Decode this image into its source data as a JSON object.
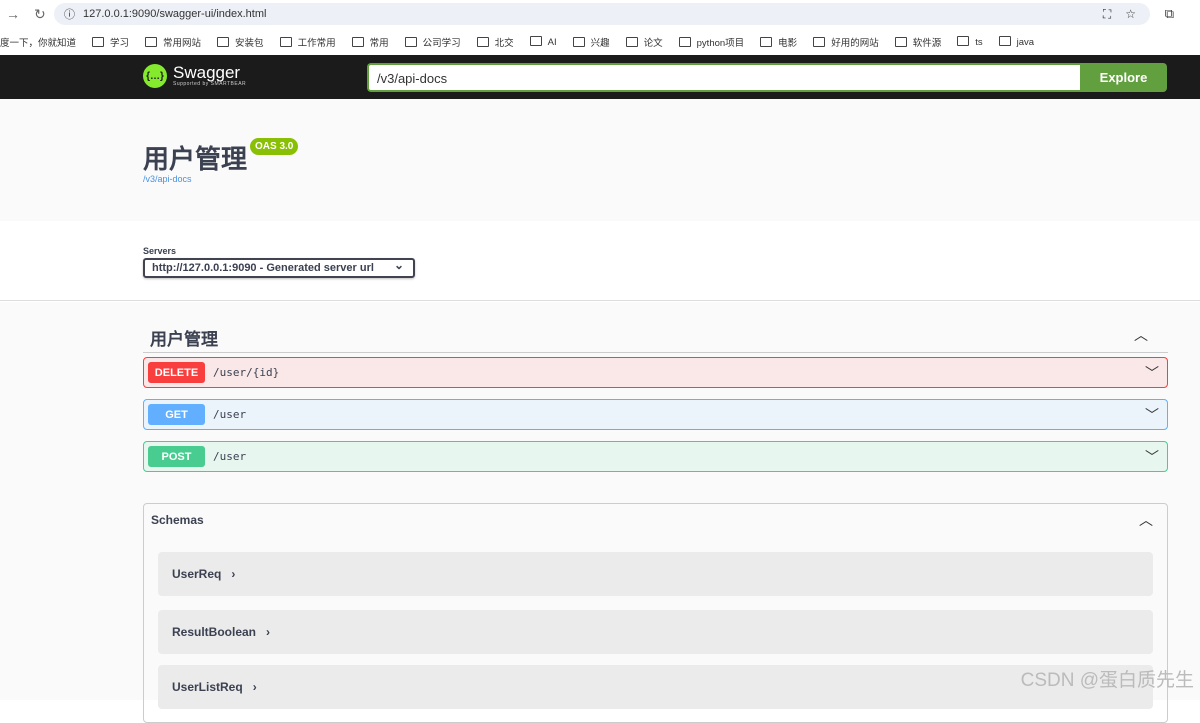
{
  "browser": {
    "url": "127.0.0.1:9090/swagger-ui/index.html",
    "bookmarks": [
      "度一下，你就知道",
      "学习",
      "常用网站",
      "安装包",
      "工作常用",
      "常用",
      "公司学习",
      "北交",
      "AI",
      "兴趣",
      "论文",
      "python项目",
      "电影",
      "好用的网站",
      "软件源",
      "ts",
      "java"
    ]
  },
  "topbar": {
    "logo": "Swagger",
    "logo_sub": "Supported by SMARTBEAR",
    "url_value": "/v3/api-docs",
    "explore": "Explore"
  },
  "info": {
    "title": "用户管理",
    "version": "OAS 3.0",
    "spec_link": "/v3/api-docs"
  },
  "servers": {
    "label": "Servers",
    "selected": "http://127.0.0.1:9090 - Generated server url"
  },
  "tag": {
    "name": "用户管理"
  },
  "operations": [
    {
      "method": "DELETE",
      "path": "/user/{id}",
      "color": "#f93e3e"
    },
    {
      "method": "GET",
      "path": "/user",
      "color": "#61affe"
    },
    {
      "method": "POST",
      "path": "/user",
      "color": "#49cc90"
    }
  ],
  "schemas": {
    "title": "Schemas",
    "models": [
      "UserReq",
      "ResultBoolean",
      "UserListReq"
    ]
  },
  "watermark": "CSDN @蛋白质先生"
}
